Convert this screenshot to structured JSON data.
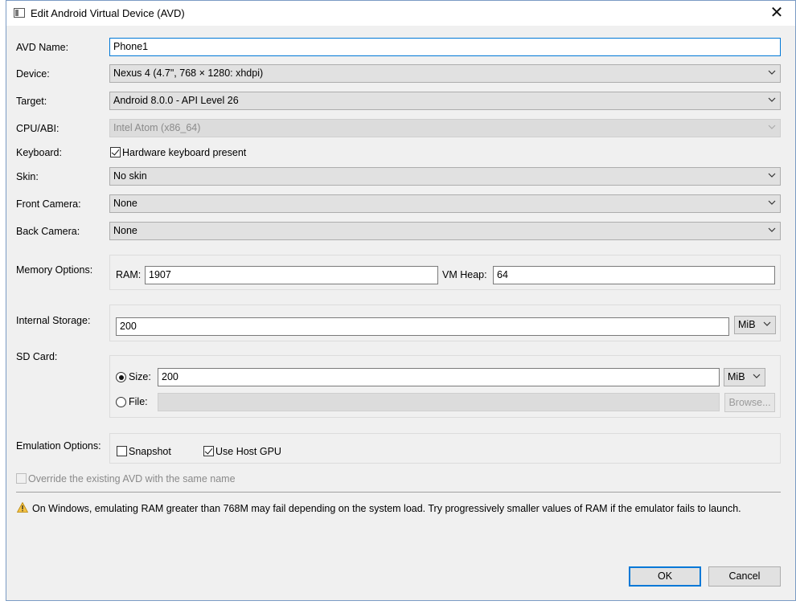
{
  "window": {
    "title": "Edit Android Virtual Device (AVD)",
    "close_glyph": "✕"
  },
  "form": {
    "avd_name": {
      "label": "AVD Name:",
      "value": "Phone1"
    },
    "device": {
      "label": "Device:",
      "value": "Nexus 4 (4.7\", 768 × 1280: xhdpi)"
    },
    "target": {
      "label": "Target:",
      "value": "Android 8.0.0 - API Level 26"
    },
    "cpu_abi": {
      "label": "CPU/ABI:",
      "value": "Intel Atom (x86_64)"
    },
    "keyboard": {
      "label": "Keyboard:",
      "checkbox_label": "Hardware keyboard present",
      "checked": true
    },
    "skin": {
      "label": "Skin:",
      "value": "No skin"
    },
    "front_camera": {
      "label": "Front Camera:",
      "value": "None"
    },
    "back_camera": {
      "label": "Back Camera:",
      "value": "None"
    },
    "memory": {
      "label": "Memory Options:",
      "ram_label": "RAM:",
      "ram_value": "1907",
      "heap_label": "VM Heap:",
      "heap_value": "64"
    },
    "internal_storage": {
      "label": "Internal Storage:",
      "value": "200",
      "unit": "MiB"
    },
    "sd_card": {
      "label": "SD Card:",
      "size_label": "Size:",
      "size_value": "200",
      "size_unit": "MiB",
      "file_label": "File:",
      "file_value": "",
      "browse_label": "Browse...",
      "selected": "size"
    },
    "emulation": {
      "label": "Emulation Options:",
      "snapshot_label": "Snapshot",
      "snapshot_checked": false,
      "gpu_label": "Use Host GPU",
      "gpu_checked": true
    },
    "override": {
      "label": "Override the existing AVD with the same name",
      "checked": false
    }
  },
  "warning": {
    "text": "On Windows, emulating RAM greater than 768M may fail depending on the system load. Try progressively smaller values of RAM if the emulator fails to launch."
  },
  "buttons": {
    "ok": "OK",
    "cancel": "Cancel"
  },
  "colors": {
    "accent": "#0078d7",
    "dialog_bg": "#f0f0f0",
    "warning": "#e8a317"
  }
}
